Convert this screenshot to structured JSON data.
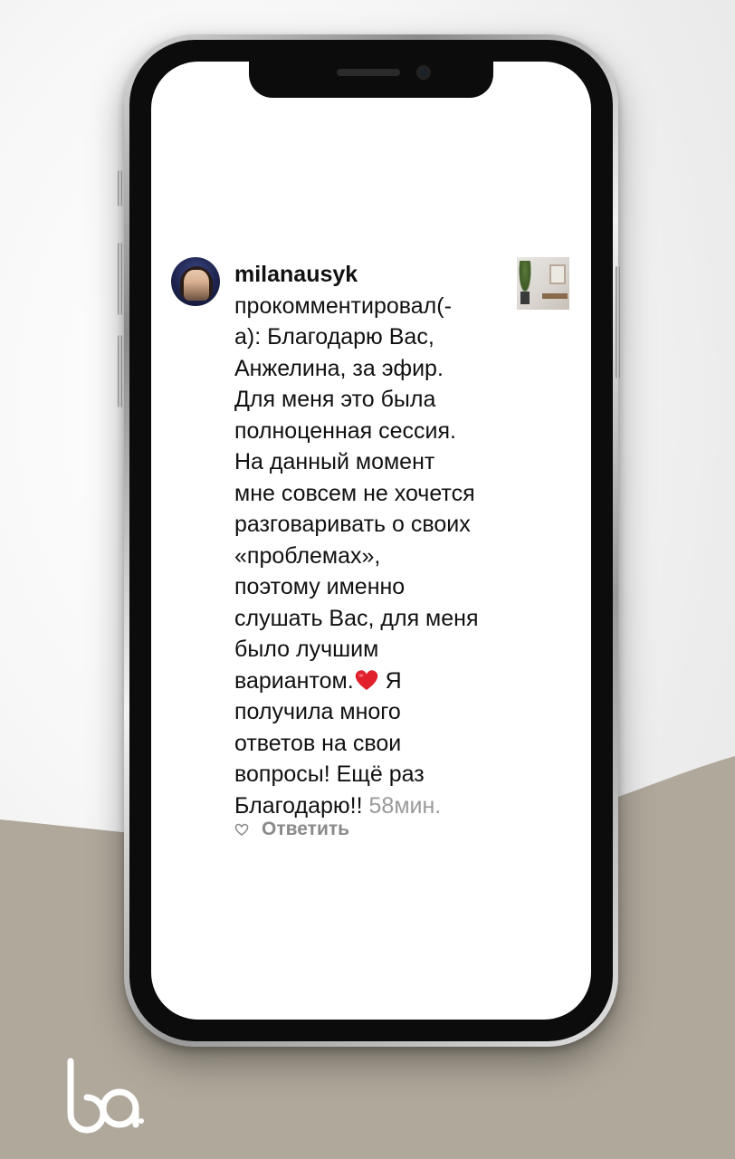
{
  "comment": {
    "username": "milanausyk",
    "text_lines": [
      "прокомментировал(-",
      "а): Благодарю Вас,",
      "Анжелина, за эфир.",
      "Для меня это была",
      "полноценная сессия.",
      "На данный момент",
      "мне совсем не хочется",
      "разговаривать о своих",
      "«проблемах»,",
      "поэтому именно",
      "слушать Вас, для меня",
      "было лучшим"
    ],
    "line_heart_before": "вариантом.",
    "line_heart_after": " Я",
    "text_lines_2": [
      "получила много",
      "ответов на свои",
      "вопросы! Ещё раз"
    ],
    "last_line": "Благодарю!! ",
    "time": "58мин.",
    "reply_label": "Ответить"
  },
  "icons": {
    "avatar": "profile-avatar",
    "thumbnail": "post-thumbnail",
    "like": "heart-outline-icon",
    "emoji": "red-heart-emoji"
  },
  "colors": {
    "background_bottom": "#b0a89b",
    "text": "#111111",
    "muted": "#9a9a9a",
    "heart": "#e0202a"
  }
}
